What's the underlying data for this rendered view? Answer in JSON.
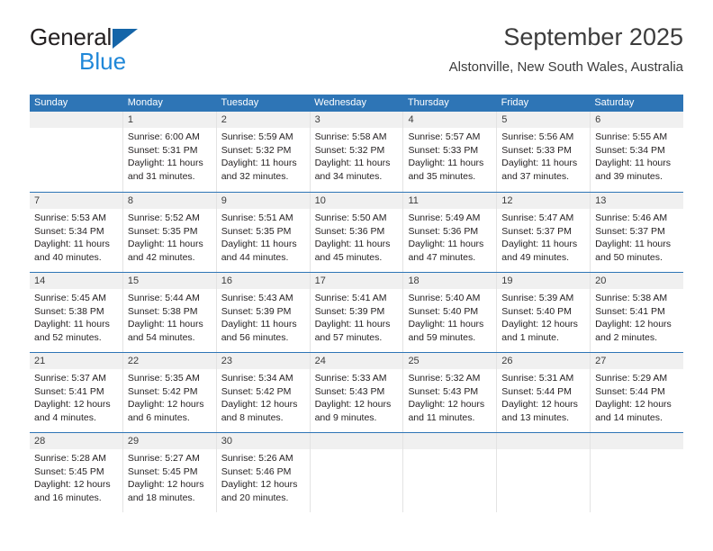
{
  "brand": {
    "name_top": "General",
    "name_bottom": "Blue",
    "triangle_color": "#1565a8",
    "blue_text_color": "#1f87d8"
  },
  "header": {
    "title": "September 2025",
    "subtitle": "Alstonville, New South Wales, Australia"
  },
  "theme": {
    "header_row_bg": "#2e75b6",
    "header_row_text": "#ffffff",
    "daynum_band_bg": "#f0f0f0",
    "row_divider": "#2e75b6",
    "cell_divider": "#e3e3e3"
  },
  "weekdays": [
    "Sunday",
    "Monday",
    "Tuesday",
    "Wednesday",
    "Thursday",
    "Friday",
    "Saturday"
  ],
  "weeks": [
    [
      {
        "day": "",
        "sunrise": "",
        "sunset": "",
        "daylight_line1": "",
        "daylight_line2": ""
      },
      {
        "day": "1",
        "sunrise": "Sunrise: 6:00 AM",
        "sunset": "Sunset: 5:31 PM",
        "daylight_line1": "Daylight: 11 hours",
        "daylight_line2": "and 31 minutes."
      },
      {
        "day": "2",
        "sunrise": "Sunrise: 5:59 AM",
        "sunset": "Sunset: 5:32 PM",
        "daylight_line1": "Daylight: 11 hours",
        "daylight_line2": "and 32 minutes."
      },
      {
        "day": "3",
        "sunrise": "Sunrise: 5:58 AM",
        "sunset": "Sunset: 5:32 PM",
        "daylight_line1": "Daylight: 11 hours",
        "daylight_line2": "and 34 minutes."
      },
      {
        "day": "4",
        "sunrise": "Sunrise: 5:57 AM",
        "sunset": "Sunset: 5:33 PM",
        "daylight_line1": "Daylight: 11 hours",
        "daylight_line2": "and 35 minutes."
      },
      {
        "day": "5",
        "sunrise": "Sunrise: 5:56 AM",
        "sunset": "Sunset: 5:33 PM",
        "daylight_line1": "Daylight: 11 hours",
        "daylight_line2": "and 37 minutes."
      },
      {
        "day": "6",
        "sunrise": "Sunrise: 5:55 AM",
        "sunset": "Sunset: 5:34 PM",
        "daylight_line1": "Daylight: 11 hours",
        "daylight_line2": "and 39 minutes."
      }
    ],
    [
      {
        "day": "7",
        "sunrise": "Sunrise: 5:53 AM",
        "sunset": "Sunset: 5:34 PM",
        "daylight_line1": "Daylight: 11 hours",
        "daylight_line2": "and 40 minutes."
      },
      {
        "day": "8",
        "sunrise": "Sunrise: 5:52 AM",
        "sunset": "Sunset: 5:35 PM",
        "daylight_line1": "Daylight: 11 hours",
        "daylight_line2": "and 42 minutes."
      },
      {
        "day": "9",
        "sunrise": "Sunrise: 5:51 AM",
        "sunset": "Sunset: 5:35 PM",
        "daylight_line1": "Daylight: 11 hours",
        "daylight_line2": "and 44 minutes."
      },
      {
        "day": "10",
        "sunrise": "Sunrise: 5:50 AM",
        "sunset": "Sunset: 5:36 PM",
        "daylight_line1": "Daylight: 11 hours",
        "daylight_line2": "and 45 minutes."
      },
      {
        "day": "11",
        "sunrise": "Sunrise: 5:49 AM",
        "sunset": "Sunset: 5:36 PM",
        "daylight_line1": "Daylight: 11 hours",
        "daylight_line2": "and 47 minutes."
      },
      {
        "day": "12",
        "sunrise": "Sunrise: 5:47 AM",
        "sunset": "Sunset: 5:37 PM",
        "daylight_line1": "Daylight: 11 hours",
        "daylight_line2": "and 49 minutes."
      },
      {
        "day": "13",
        "sunrise": "Sunrise: 5:46 AM",
        "sunset": "Sunset: 5:37 PM",
        "daylight_line1": "Daylight: 11 hours",
        "daylight_line2": "and 50 minutes."
      }
    ],
    [
      {
        "day": "14",
        "sunrise": "Sunrise: 5:45 AM",
        "sunset": "Sunset: 5:38 PM",
        "daylight_line1": "Daylight: 11 hours",
        "daylight_line2": "and 52 minutes."
      },
      {
        "day": "15",
        "sunrise": "Sunrise: 5:44 AM",
        "sunset": "Sunset: 5:38 PM",
        "daylight_line1": "Daylight: 11 hours",
        "daylight_line2": "and 54 minutes."
      },
      {
        "day": "16",
        "sunrise": "Sunrise: 5:43 AM",
        "sunset": "Sunset: 5:39 PM",
        "daylight_line1": "Daylight: 11 hours",
        "daylight_line2": "and 56 minutes."
      },
      {
        "day": "17",
        "sunrise": "Sunrise: 5:41 AM",
        "sunset": "Sunset: 5:39 PM",
        "daylight_line1": "Daylight: 11 hours",
        "daylight_line2": "and 57 minutes."
      },
      {
        "day": "18",
        "sunrise": "Sunrise: 5:40 AM",
        "sunset": "Sunset: 5:40 PM",
        "daylight_line1": "Daylight: 11 hours",
        "daylight_line2": "and 59 minutes."
      },
      {
        "day": "19",
        "sunrise": "Sunrise: 5:39 AM",
        "sunset": "Sunset: 5:40 PM",
        "daylight_line1": "Daylight: 12 hours",
        "daylight_line2": "and 1 minute."
      },
      {
        "day": "20",
        "sunrise": "Sunrise: 5:38 AM",
        "sunset": "Sunset: 5:41 PM",
        "daylight_line1": "Daylight: 12 hours",
        "daylight_line2": "and 2 minutes."
      }
    ],
    [
      {
        "day": "21",
        "sunrise": "Sunrise: 5:37 AM",
        "sunset": "Sunset: 5:41 PM",
        "daylight_line1": "Daylight: 12 hours",
        "daylight_line2": "and 4 minutes."
      },
      {
        "day": "22",
        "sunrise": "Sunrise: 5:35 AM",
        "sunset": "Sunset: 5:42 PM",
        "daylight_line1": "Daylight: 12 hours",
        "daylight_line2": "and 6 minutes."
      },
      {
        "day": "23",
        "sunrise": "Sunrise: 5:34 AM",
        "sunset": "Sunset: 5:42 PM",
        "daylight_line1": "Daylight: 12 hours",
        "daylight_line2": "and 8 minutes."
      },
      {
        "day": "24",
        "sunrise": "Sunrise: 5:33 AM",
        "sunset": "Sunset: 5:43 PM",
        "daylight_line1": "Daylight: 12 hours",
        "daylight_line2": "and 9 minutes."
      },
      {
        "day": "25",
        "sunrise": "Sunrise: 5:32 AM",
        "sunset": "Sunset: 5:43 PM",
        "daylight_line1": "Daylight: 12 hours",
        "daylight_line2": "and 11 minutes."
      },
      {
        "day": "26",
        "sunrise": "Sunrise: 5:31 AM",
        "sunset": "Sunset: 5:44 PM",
        "daylight_line1": "Daylight: 12 hours",
        "daylight_line2": "and 13 minutes."
      },
      {
        "day": "27",
        "sunrise": "Sunrise: 5:29 AM",
        "sunset": "Sunset: 5:44 PM",
        "daylight_line1": "Daylight: 12 hours",
        "daylight_line2": "and 14 minutes."
      }
    ],
    [
      {
        "day": "28",
        "sunrise": "Sunrise: 5:28 AM",
        "sunset": "Sunset: 5:45 PM",
        "daylight_line1": "Daylight: 12 hours",
        "daylight_line2": "and 16 minutes."
      },
      {
        "day": "29",
        "sunrise": "Sunrise: 5:27 AM",
        "sunset": "Sunset: 5:45 PM",
        "daylight_line1": "Daylight: 12 hours",
        "daylight_line2": "and 18 minutes."
      },
      {
        "day": "30",
        "sunrise": "Sunrise: 5:26 AM",
        "sunset": "Sunset: 5:46 PM",
        "daylight_line1": "Daylight: 12 hours",
        "daylight_line2": "and 20 minutes."
      },
      {
        "day": "",
        "sunrise": "",
        "sunset": "",
        "daylight_line1": "",
        "daylight_line2": ""
      },
      {
        "day": "",
        "sunrise": "",
        "sunset": "",
        "daylight_line1": "",
        "daylight_line2": ""
      },
      {
        "day": "",
        "sunrise": "",
        "sunset": "",
        "daylight_line1": "",
        "daylight_line2": ""
      },
      {
        "day": "",
        "sunrise": "",
        "sunset": "",
        "daylight_line1": "",
        "daylight_line2": ""
      }
    ]
  ]
}
